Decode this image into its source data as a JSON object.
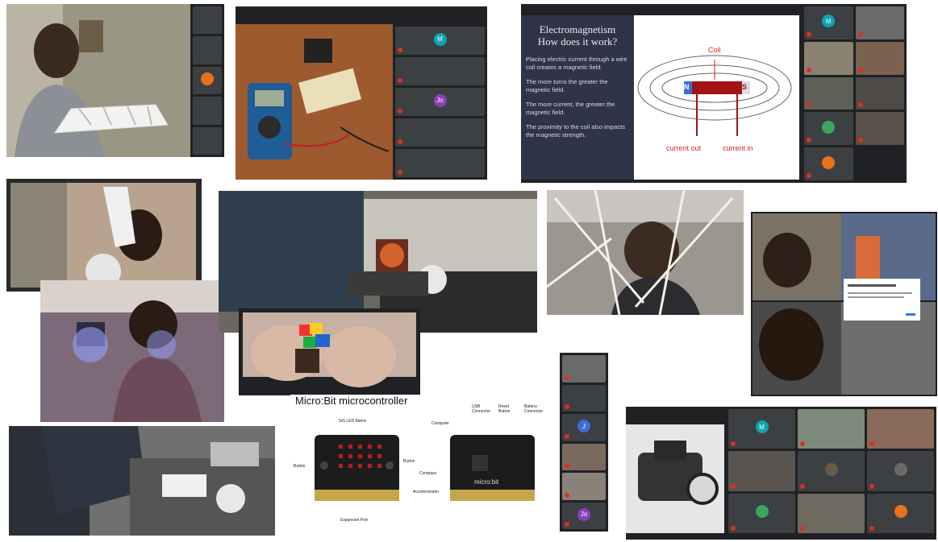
{
  "slide": {
    "title_line1": "Electromagnetism",
    "title_line2": "How does it work?",
    "bullets": [
      "Placing electric current through a wire coil creates a magnetic field.",
      "The more turns the greater the magnetic field.",
      "The more current, the greater the magnetic field.",
      "The proximity to the coil also impacts the magnetic strength."
    ],
    "diagram": {
      "coil": "Coil",
      "north": "N",
      "south": "S",
      "current_out": "current out",
      "current_in": "current in"
    }
  },
  "microbit": {
    "title": "Micro:Bit microcontroller",
    "front_labels": [
      "5x5 LED Matrix",
      "Button",
      "Button",
      "Expansion Port"
    ],
    "back_labels": [
      "USB Connector",
      "Reset Button",
      "Battery Connector",
      "Computer",
      "Compass",
      "Accelerometer"
    ],
    "board_text": "micro:bit"
  },
  "avatars": {
    "m": "M",
    "jo": "Jo",
    "j": "J"
  },
  "colors": {
    "meet_bg": "#202124",
    "meet_tile": "#3c4043",
    "slide_dark": "#2f3447",
    "mic_off": "#d93025",
    "avatar_teal": "#12a4af",
    "avatar_purple": "#8e3fb8",
    "avatar_orange": "#e8711a"
  }
}
